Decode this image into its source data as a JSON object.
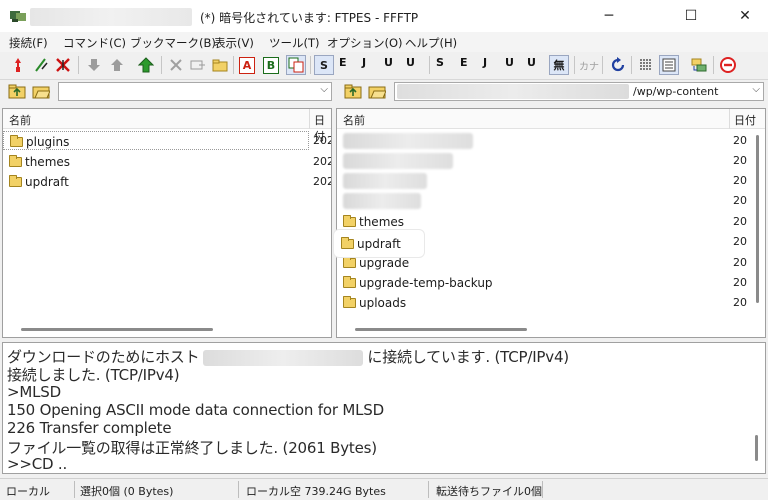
{
  "window": {
    "title": "(*) 暗号化されています: FTPES - FFFTP",
    "controls": {
      "minimize": "─",
      "maximize": "☐",
      "close": "✕"
    }
  },
  "menu": [
    "接続(F)",
    "コマンド(C)",
    "ブックマーク(B)",
    "表示(V)",
    "ツール(T)",
    "オプション(O)",
    "ヘルプ(H)"
  ],
  "toolbar": {
    "mode_buttons": [
      "S",
      "E",
      "J",
      "U",
      "U",
      "S",
      "E",
      "J",
      "U",
      "U"
    ],
    "no_convert": "無",
    "kana": "カナ"
  },
  "local": {
    "header_name": "名前",
    "header_date": "日付",
    "items": [
      {
        "name": "plugins",
        "date": "202"
      },
      {
        "name": "themes",
        "date": "202"
      },
      {
        "name": "updraft",
        "date": "202"
      }
    ]
  },
  "remote": {
    "path": "/wp/wp-content",
    "header_name": "名前",
    "header_date": "日付",
    "hidden_dates": [
      "20",
      "20",
      "20",
      "20",
      "20"
    ],
    "items": [
      {
        "name": "themes",
        "date": "20"
      },
      {
        "name": "updraft",
        "date": "20"
      },
      {
        "name": "upgrade",
        "date": "20"
      },
      {
        "name": "upgrade-temp-backup",
        "date": "20"
      },
      {
        "name": "uploads",
        "date": "20"
      }
    ]
  },
  "log": {
    "line1_before": "ダウンロードのためにホスト",
    "line1_after": "に接続しています. (TCP/IPv4)",
    "lines": [
      "接続しました. (TCP/IPv4)",
      ">MLSD",
      "150 Opening ASCII mode data connection for MLSD",
      "226 Transfer complete",
      "ファイル一覧の取得は正常終了しました. (2061 Bytes)",
      ">>CD .."
    ]
  },
  "status": {
    "location": "ローカル",
    "selection": "選択0個 (0 Bytes)",
    "free": "ローカル空 739.24G Bytes",
    "queue": "転送待ちファイル0個"
  },
  "colors": {
    "accent": "#dce6f7",
    "folder": "#f2d166"
  }
}
